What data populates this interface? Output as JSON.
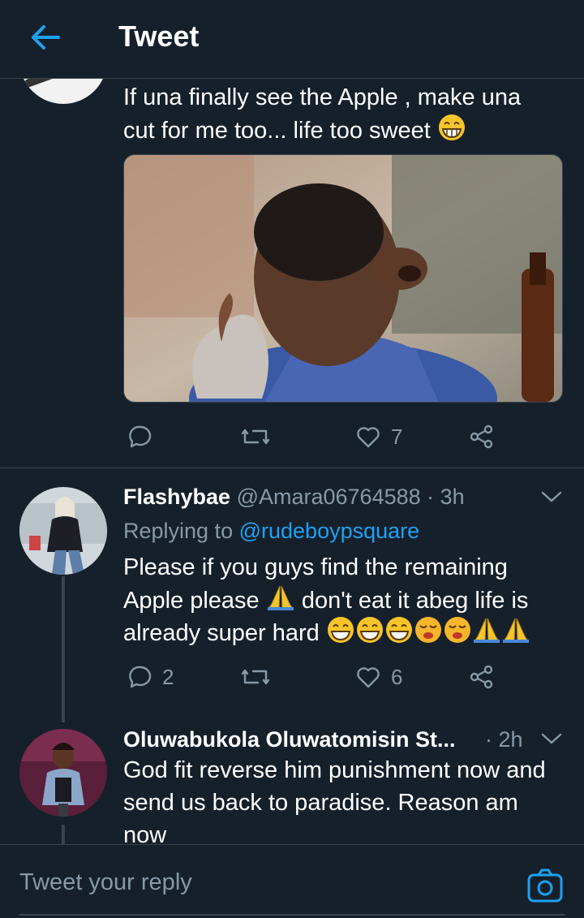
{
  "header": {
    "title": "Tweet"
  },
  "tweet1": {
    "text_line1": "If una finally see the Apple , make una",
    "text_line2": "cut for me too... life too sweet",
    "likes": "7"
  },
  "reply1": {
    "name": "Flashybae",
    "handle": "@Amara06764588",
    "time": "· 3h",
    "replying_prefix": "Replying to",
    "replying_handle": "@rudeboypsquare",
    "text_line1": "Please if you guys find the remaining",
    "text_line2a": "Apple please",
    "text_line2b": "don't eat it abeg life is",
    "text_line3": "already super hard",
    "replies": "2",
    "likes": "6"
  },
  "reply2": {
    "name": "Oluwabukola Oluwatomisin St...",
    "time": "· 2h",
    "text_line1": "God fit reverse him punishment now and",
    "text_line2": "send us back to paradise. Reason am",
    "text_line3": "now"
  },
  "composer": {
    "placeholder": "Tweet your reply"
  },
  "colors": {
    "background": "#15202b",
    "accent": "#1da1f2",
    "muted": "#8899a6",
    "divider": "#38444d"
  }
}
